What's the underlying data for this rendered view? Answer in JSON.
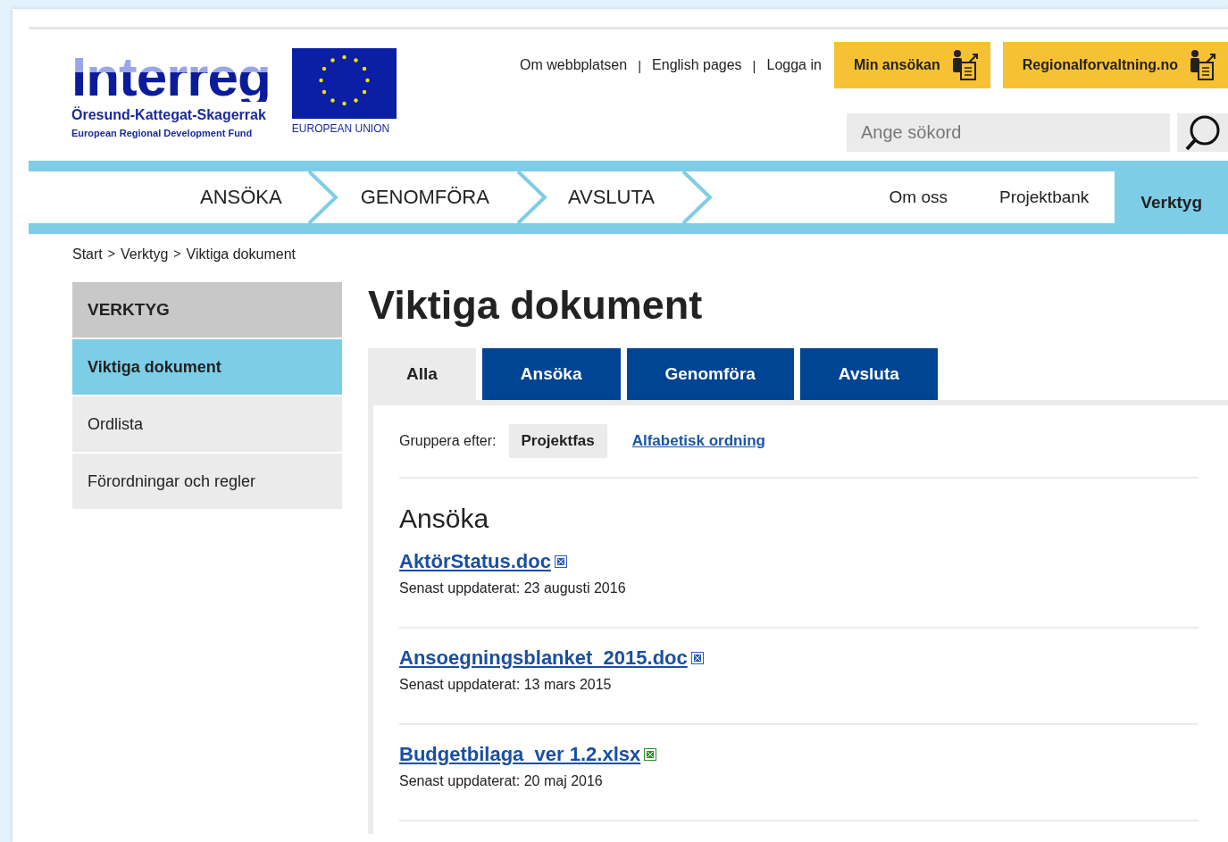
{
  "logo": {
    "name": "Interreg",
    "region": "Öresund-Kattegat-Skagerrak",
    "fund": "European Regional Development Fund",
    "eu": "EUROPEAN UNION"
  },
  "top_links": [
    "Om webbplatsen",
    "English pages",
    "Logga in"
  ],
  "top_link_separators": [
    "|",
    "|"
  ],
  "action_buttons": [
    "Min ansökan",
    "Regionalforvaltning.no"
  ],
  "search": {
    "placeholder": "Ange sökord"
  },
  "phase_nav": [
    "ANSÖKA",
    "GENOMFÖRA",
    "AVSLUTA"
  ],
  "side_nav": [
    {
      "label": "Om oss",
      "selected": false
    },
    {
      "label": "Projektbank",
      "selected": false
    },
    {
      "label": "Verktyg",
      "selected": true
    }
  ],
  "breadcrumb": [
    "Start",
    "Verktyg",
    "Viktiga dokument"
  ],
  "breadcrumb_separators": [
    ">",
    ">"
  ],
  "sidebar": {
    "title": "VERKTYG",
    "items": [
      {
        "label": "Viktiga dokument",
        "selected": true
      },
      {
        "label": "Ordlista",
        "selected": false
      },
      {
        "label": "Förordningar och regler",
        "selected": false
      }
    ]
  },
  "page_title": "Viktiga dokument",
  "tabs": [
    {
      "label": "Alla",
      "selected": true
    },
    {
      "label": "Ansöka",
      "selected": false
    },
    {
      "label": "Genomföra",
      "selected": false
    },
    {
      "label": "Avsluta",
      "selected": false
    }
  ],
  "group_by": {
    "label": "Gruppera efter:",
    "options": [
      {
        "label": "Projektfas",
        "selected": true
      },
      {
        "label": "Alfabetisk ordning",
        "selected": false
      }
    ]
  },
  "section_title": "Ansöka",
  "documents": [
    {
      "name": "AktörStatus.doc",
      "kind": "word",
      "updated": "Senast uppdaterat: 23 augusti 2016"
    },
    {
      "name": "Ansoegningsblanket_2015.doc",
      "kind": "word",
      "updated": "Senast uppdaterat: 13 mars 2015"
    },
    {
      "name": "Budgetbilaga_ver 1.2.xlsx",
      "kind": "excel",
      "updated": "Senast uppdaterat: 20 maj 2016"
    }
  ]
}
